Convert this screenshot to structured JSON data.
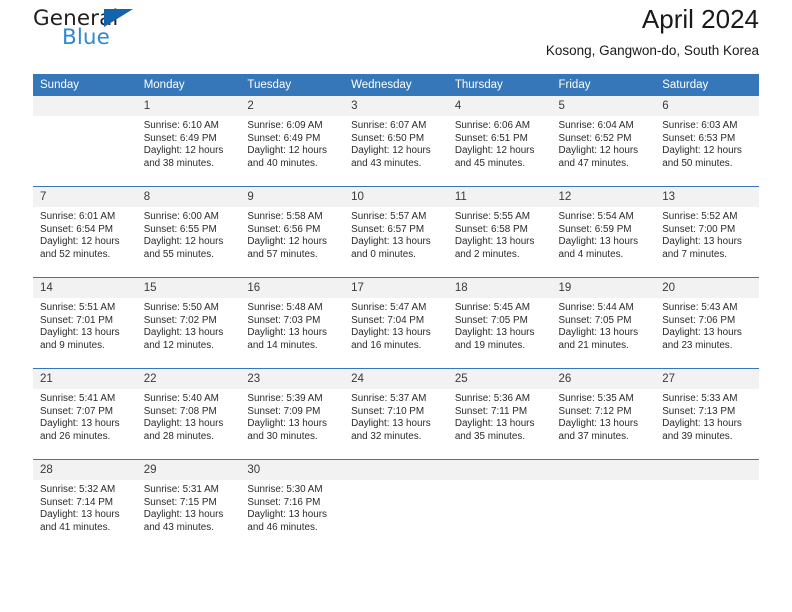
{
  "brand": {
    "name_part1": "General",
    "name_part2": "Blue",
    "triangle_color": "#1464ad",
    "blue_color": "#2e8bd0"
  },
  "header": {
    "title": "April 2024",
    "subtitle": "Kosong, Gangwon-do, South Korea",
    "header_bg_color": "#3577b8",
    "header_text_color": "#ffffff",
    "daynum_bg_color": "#f2f2f2"
  },
  "weekdays": [
    "Sunday",
    "Monday",
    "Tuesday",
    "Wednesday",
    "Thursday",
    "Friday",
    "Saturday"
  ],
  "labels": {
    "sunrise": "Sunrise:",
    "sunset": "Sunset:",
    "daylight": "Daylight:"
  },
  "weeks": [
    [
      {
        "day": "",
        "sunrise": "",
        "sunset": "",
        "daylight": "",
        "empty": true
      },
      {
        "day": "1",
        "sunrise": "Sunrise: 6:10 AM",
        "sunset": "Sunset: 6:49 PM",
        "daylight": "Daylight: 12 hours and 38 minutes."
      },
      {
        "day": "2",
        "sunrise": "Sunrise: 6:09 AM",
        "sunset": "Sunset: 6:49 PM",
        "daylight": "Daylight: 12 hours and 40 minutes."
      },
      {
        "day": "3",
        "sunrise": "Sunrise: 6:07 AM",
        "sunset": "Sunset: 6:50 PM",
        "daylight": "Daylight: 12 hours and 43 minutes."
      },
      {
        "day": "4",
        "sunrise": "Sunrise: 6:06 AM",
        "sunset": "Sunset: 6:51 PM",
        "daylight": "Daylight: 12 hours and 45 minutes."
      },
      {
        "day": "5",
        "sunrise": "Sunrise: 6:04 AM",
        "sunset": "Sunset: 6:52 PM",
        "daylight": "Daylight: 12 hours and 47 minutes."
      },
      {
        "day": "6",
        "sunrise": "Sunrise: 6:03 AM",
        "sunset": "Sunset: 6:53 PM",
        "daylight": "Daylight: 12 hours and 50 minutes."
      }
    ],
    [
      {
        "day": "7",
        "sunrise": "Sunrise: 6:01 AM",
        "sunset": "Sunset: 6:54 PM",
        "daylight": "Daylight: 12 hours and 52 minutes."
      },
      {
        "day": "8",
        "sunrise": "Sunrise: 6:00 AM",
        "sunset": "Sunset: 6:55 PM",
        "daylight": "Daylight: 12 hours and 55 minutes."
      },
      {
        "day": "9",
        "sunrise": "Sunrise: 5:58 AM",
        "sunset": "Sunset: 6:56 PM",
        "daylight": "Daylight: 12 hours and 57 minutes."
      },
      {
        "day": "10",
        "sunrise": "Sunrise: 5:57 AM",
        "sunset": "Sunset: 6:57 PM",
        "daylight": "Daylight: 13 hours and 0 minutes."
      },
      {
        "day": "11",
        "sunrise": "Sunrise: 5:55 AM",
        "sunset": "Sunset: 6:58 PM",
        "daylight": "Daylight: 13 hours and 2 minutes."
      },
      {
        "day": "12",
        "sunrise": "Sunrise: 5:54 AM",
        "sunset": "Sunset: 6:59 PM",
        "daylight": "Daylight: 13 hours and 4 minutes."
      },
      {
        "day": "13",
        "sunrise": "Sunrise: 5:52 AM",
        "sunset": "Sunset: 7:00 PM",
        "daylight": "Daylight: 13 hours and 7 minutes."
      }
    ],
    [
      {
        "day": "14",
        "sunrise": "Sunrise: 5:51 AM",
        "sunset": "Sunset: 7:01 PM",
        "daylight": "Daylight: 13 hours and 9 minutes."
      },
      {
        "day": "15",
        "sunrise": "Sunrise: 5:50 AM",
        "sunset": "Sunset: 7:02 PM",
        "daylight": "Daylight: 13 hours and 12 minutes."
      },
      {
        "day": "16",
        "sunrise": "Sunrise: 5:48 AM",
        "sunset": "Sunset: 7:03 PM",
        "daylight": "Daylight: 13 hours and 14 minutes."
      },
      {
        "day": "17",
        "sunrise": "Sunrise: 5:47 AM",
        "sunset": "Sunset: 7:04 PM",
        "daylight": "Daylight: 13 hours and 16 minutes."
      },
      {
        "day": "18",
        "sunrise": "Sunrise: 5:45 AM",
        "sunset": "Sunset: 7:05 PM",
        "daylight": "Daylight: 13 hours and 19 minutes."
      },
      {
        "day": "19",
        "sunrise": "Sunrise: 5:44 AM",
        "sunset": "Sunset: 7:05 PM",
        "daylight": "Daylight: 13 hours and 21 minutes."
      },
      {
        "day": "20",
        "sunrise": "Sunrise: 5:43 AM",
        "sunset": "Sunset: 7:06 PM",
        "daylight": "Daylight: 13 hours and 23 minutes."
      }
    ],
    [
      {
        "day": "21",
        "sunrise": "Sunrise: 5:41 AM",
        "sunset": "Sunset: 7:07 PM",
        "daylight": "Daylight: 13 hours and 26 minutes."
      },
      {
        "day": "22",
        "sunrise": "Sunrise: 5:40 AM",
        "sunset": "Sunset: 7:08 PM",
        "daylight": "Daylight: 13 hours and 28 minutes."
      },
      {
        "day": "23",
        "sunrise": "Sunrise: 5:39 AM",
        "sunset": "Sunset: 7:09 PM",
        "daylight": "Daylight: 13 hours and 30 minutes."
      },
      {
        "day": "24",
        "sunrise": "Sunrise: 5:37 AM",
        "sunset": "Sunset: 7:10 PM",
        "daylight": "Daylight: 13 hours and 32 minutes."
      },
      {
        "day": "25",
        "sunrise": "Sunrise: 5:36 AM",
        "sunset": "Sunset: 7:11 PM",
        "daylight": "Daylight: 13 hours and 35 minutes."
      },
      {
        "day": "26",
        "sunrise": "Sunrise: 5:35 AM",
        "sunset": "Sunset: 7:12 PM",
        "daylight": "Daylight: 13 hours and 37 minutes."
      },
      {
        "day": "27",
        "sunrise": "Sunrise: 5:33 AM",
        "sunset": "Sunset: 7:13 PM",
        "daylight": "Daylight: 13 hours and 39 minutes."
      }
    ],
    [
      {
        "day": "28",
        "sunrise": "Sunrise: 5:32 AM",
        "sunset": "Sunset: 7:14 PM",
        "daylight": "Daylight: 13 hours and 41 minutes."
      },
      {
        "day": "29",
        "sunrise": "Sunrise: 5:31 AM",
        "sunset": "Sunset: 7:15 PM",
        "daylight": "Daylight: 13 hours and 43 minutes."
      },
      {
        "day": "30",
        "sunrise": "Sunrise: 5:30 AM",
        "sunset": "Sunset: 7:16 PM",
        "daylight": "Daylight: 13 hours and 46 minutes."
      },
      {
        "day": "",
        "sunrise": "",
        "sunset": "",
        "daylight": "",
        "empty": true
      },
      {
        "day": "",
        "sunrise": "",
        "sunset": "",
        "daylight": "",
        "empty": true
      },
      {
        "day": "",
        "sunrise": "",
        "sunset": "",
        "daylight": "",
        "empty": true
      },
      {
        "day": "",
        "sunrise": "",
        "sunset": "",
        "daylight": "",
        "empty": true
      }
    ]
  ]
}
